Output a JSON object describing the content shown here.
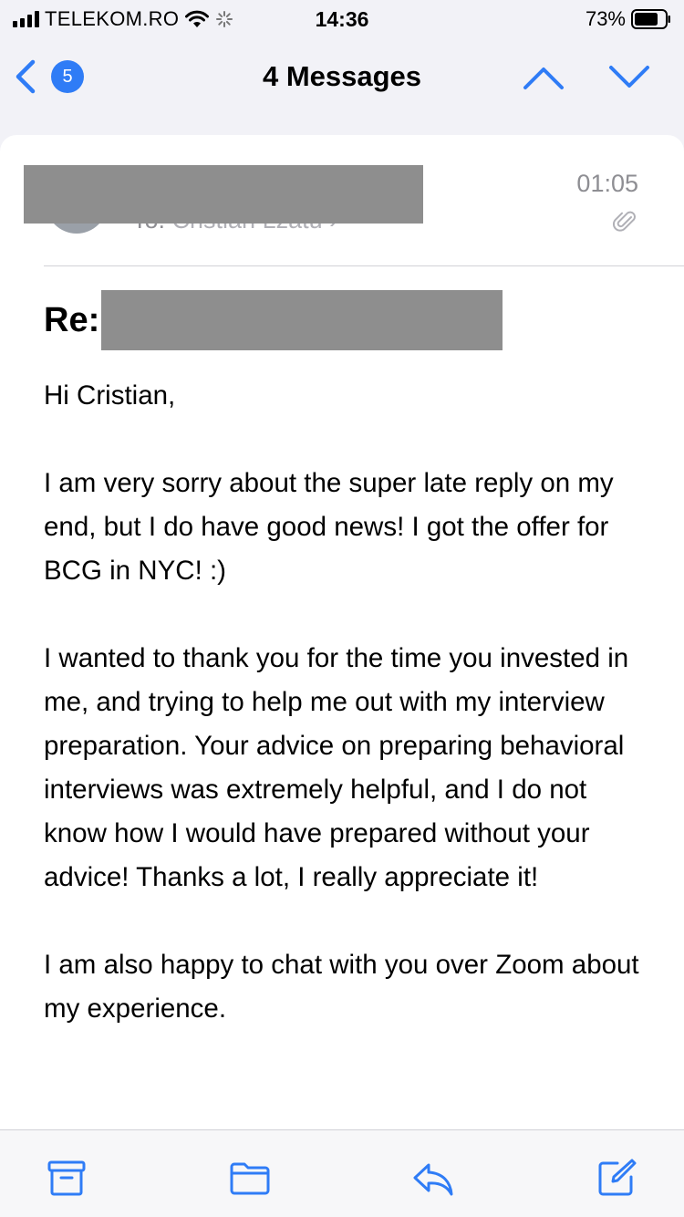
{
  "status_bar": {
    "carrier": "TELEKOM.RO",
    "time": "14:36",
    "battery_percent": "73%"
  },
  "nav": {
    "unread_count": "5",
    "title": "4 Messages"
  },
  "message": {
    "to_label": "To:",
    "to_name": "Cristian Lzatu",
    "time": "01:05",
    "subject_prefix": "Re:",
    "body": [
      "Hi Cristian,",
      "I am very sorry about the super late reply on my end, but I do have good news! I got the offer for BCG in NYC! :)",
      "I wanted to thank you for the time you invested in me, and trying to help me out with my interview preparation. Your advice on preparing behavioral interviews was extremely helpful, and I do not know how I would have prepared without your advice! Thanks a lot, I really appreciate it!",
      "I am also happy to chat with you over Zoom about my experience."
    ]
  },
  "colors": {
    "accent": "#2f7cf6",
    "redaction": "#8e8e8e",
    "secondary_text": "#8e8e93"
  },
  "icons": {
    "toolbar": [
      "archive-icon",
      "folder-icon",
      "reply-icon",
      "compose-icon"
    ]
  }
}
